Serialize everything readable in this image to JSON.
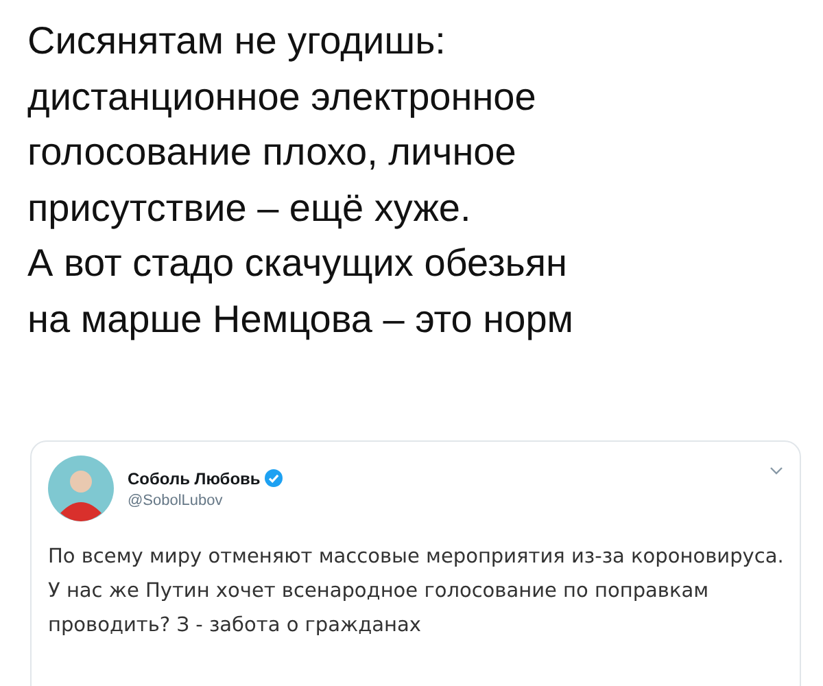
{
  "caption": {
    "lines": [
      "Сисянятам не угодишь:",
      "дистанционное электронное",
      "голосование плохо, личное",
      "присутствие – ещё хуже.",
      "А вот стадо скачущих обезьян",
      "на марше Немцова – это норм"
    ]
  },
  "tweet": {
    "author": "Соболь Любовь",
    "verified": true,
    "handle": "@SobolLubov",
    "text": "По всему миру отменяют массовые мероприятия из-за короновируса. У нас же Путин хочет всенародное голосование по поправкам проводить? З - забота о гражданах"
  }
}
